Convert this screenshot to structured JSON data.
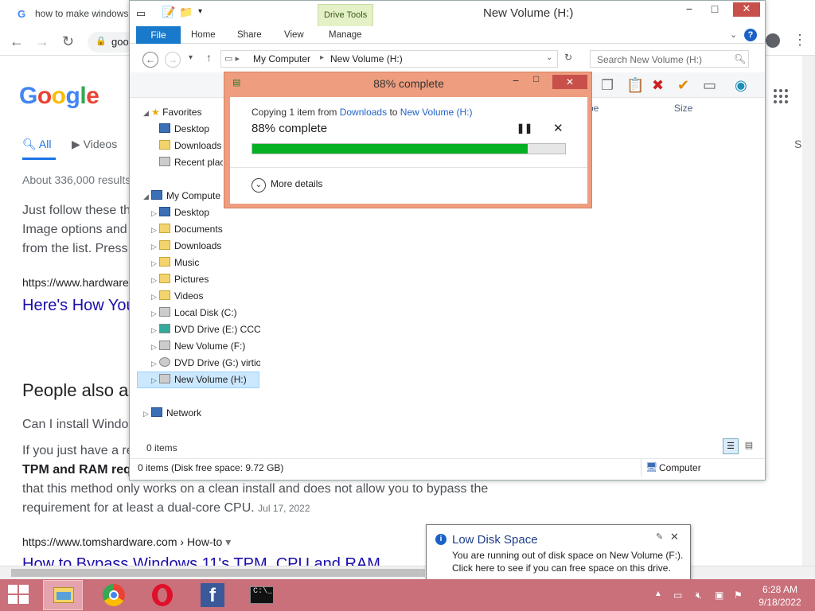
{
  "browser": {
    "tab_title": "how to make windows",
    "omnibox_text": "goo"
  },
  "google": {
    "logo": "Google",
    "tabs": [
      {
        "label": "All"
      },
      {
        "label": "Videos"
      },
      {
        "label": "S"
      }
    ],
    "results_count": "About 336,000 results",
    "snippet1": [
      "Just follow these th",
      "Image options and",
      "from the list. Press"
    ],
    "cite1": "https://www.hardware",
    "link1": "Here's How You",
    "paa_title": "People also a",
    "question1": "Can I install Windo",
    "snippet2_a": "If you just have a re",
    "snippet2_b": "TPM and RAM req",
    "snippet2_c": "that this method only works on a clean install and does not allow you to bypass the",
    "snippet2_d": "requirement for at least a dual-core CPU.",
    "snippet2_date": "Jul 17, 2022",
    "cite2": "https://www.tomshardware.com › How-to",
    "link2": "How to Bypass Windows 11's TPM, CPU and RAM"
  },
  "explorer": {
    "title": "New Volume (H:)",
    "context_tab": "Drive Tools",
    "ribbon_tabs": [
      "File",
      "Home",
      "Share",
      "View",
      "Manage"
    ],
    "breadcrumb": [
      "My Computer",
      "New Volume (H:)"
    ],
    "search_placeholder": "Search New Volume (H:)",
    "column_type": "pe",
    "column_size": "Size",
    "nav": {
      "favorites": "Favorites",
      "fav_items": [
        "Desktop",
        "Downloads",
        "Recent plac"
      ],
      "computer": "My Compute",
      "computer_items": [
        "Desktop",
        "Documents",
        "Downloads",
        "Music",
        "Pictures",
        "Videos",
        "Local Disk (C:)",
        "DVD Drive (E:) CCCC",
        "New Volume (F:)",
        "DVD Drive (G:) virtio",
        "New Volume (H:)"
      ],
      "network": "Network"
    },
    "items_count": "0 items",
    "status_left": "0 items (Disk free space: 9.72 GB)",
    "status_right": "Computer"
  },
  "copy_dialog": {
    "title": "88% complete",
    "copy_prefix": "Copying 1 item from",
    "source": "Downloads",
    "to_word": "to",
    "destination": "New Volume (H:)",
    "percent_label": "88% complete",
    "progress": 0.88,
    "more_details": "More details"
  },
  "balloon": {
    "title": "Low Disk Space",
    "line1": "You are running out of disk space on New Volume (F:).",
    "line2": "Click here to see if you can free space on this drive."
  },
  "taskbar": {
    "time": "6:28 AM",
    "date": "9/18/2022",
    "apps": [
      "file-explorer",
      "chrome",
      "opera",
      "facebook",
      "command-prompt"
    ]
  },
  "colors": {
    "taskbar": "#c9707a",
    "dialog_frame": "#ef9d7f",
    "progress": "#06b025",
    "file_tab": "#1979ca"
  }
}
